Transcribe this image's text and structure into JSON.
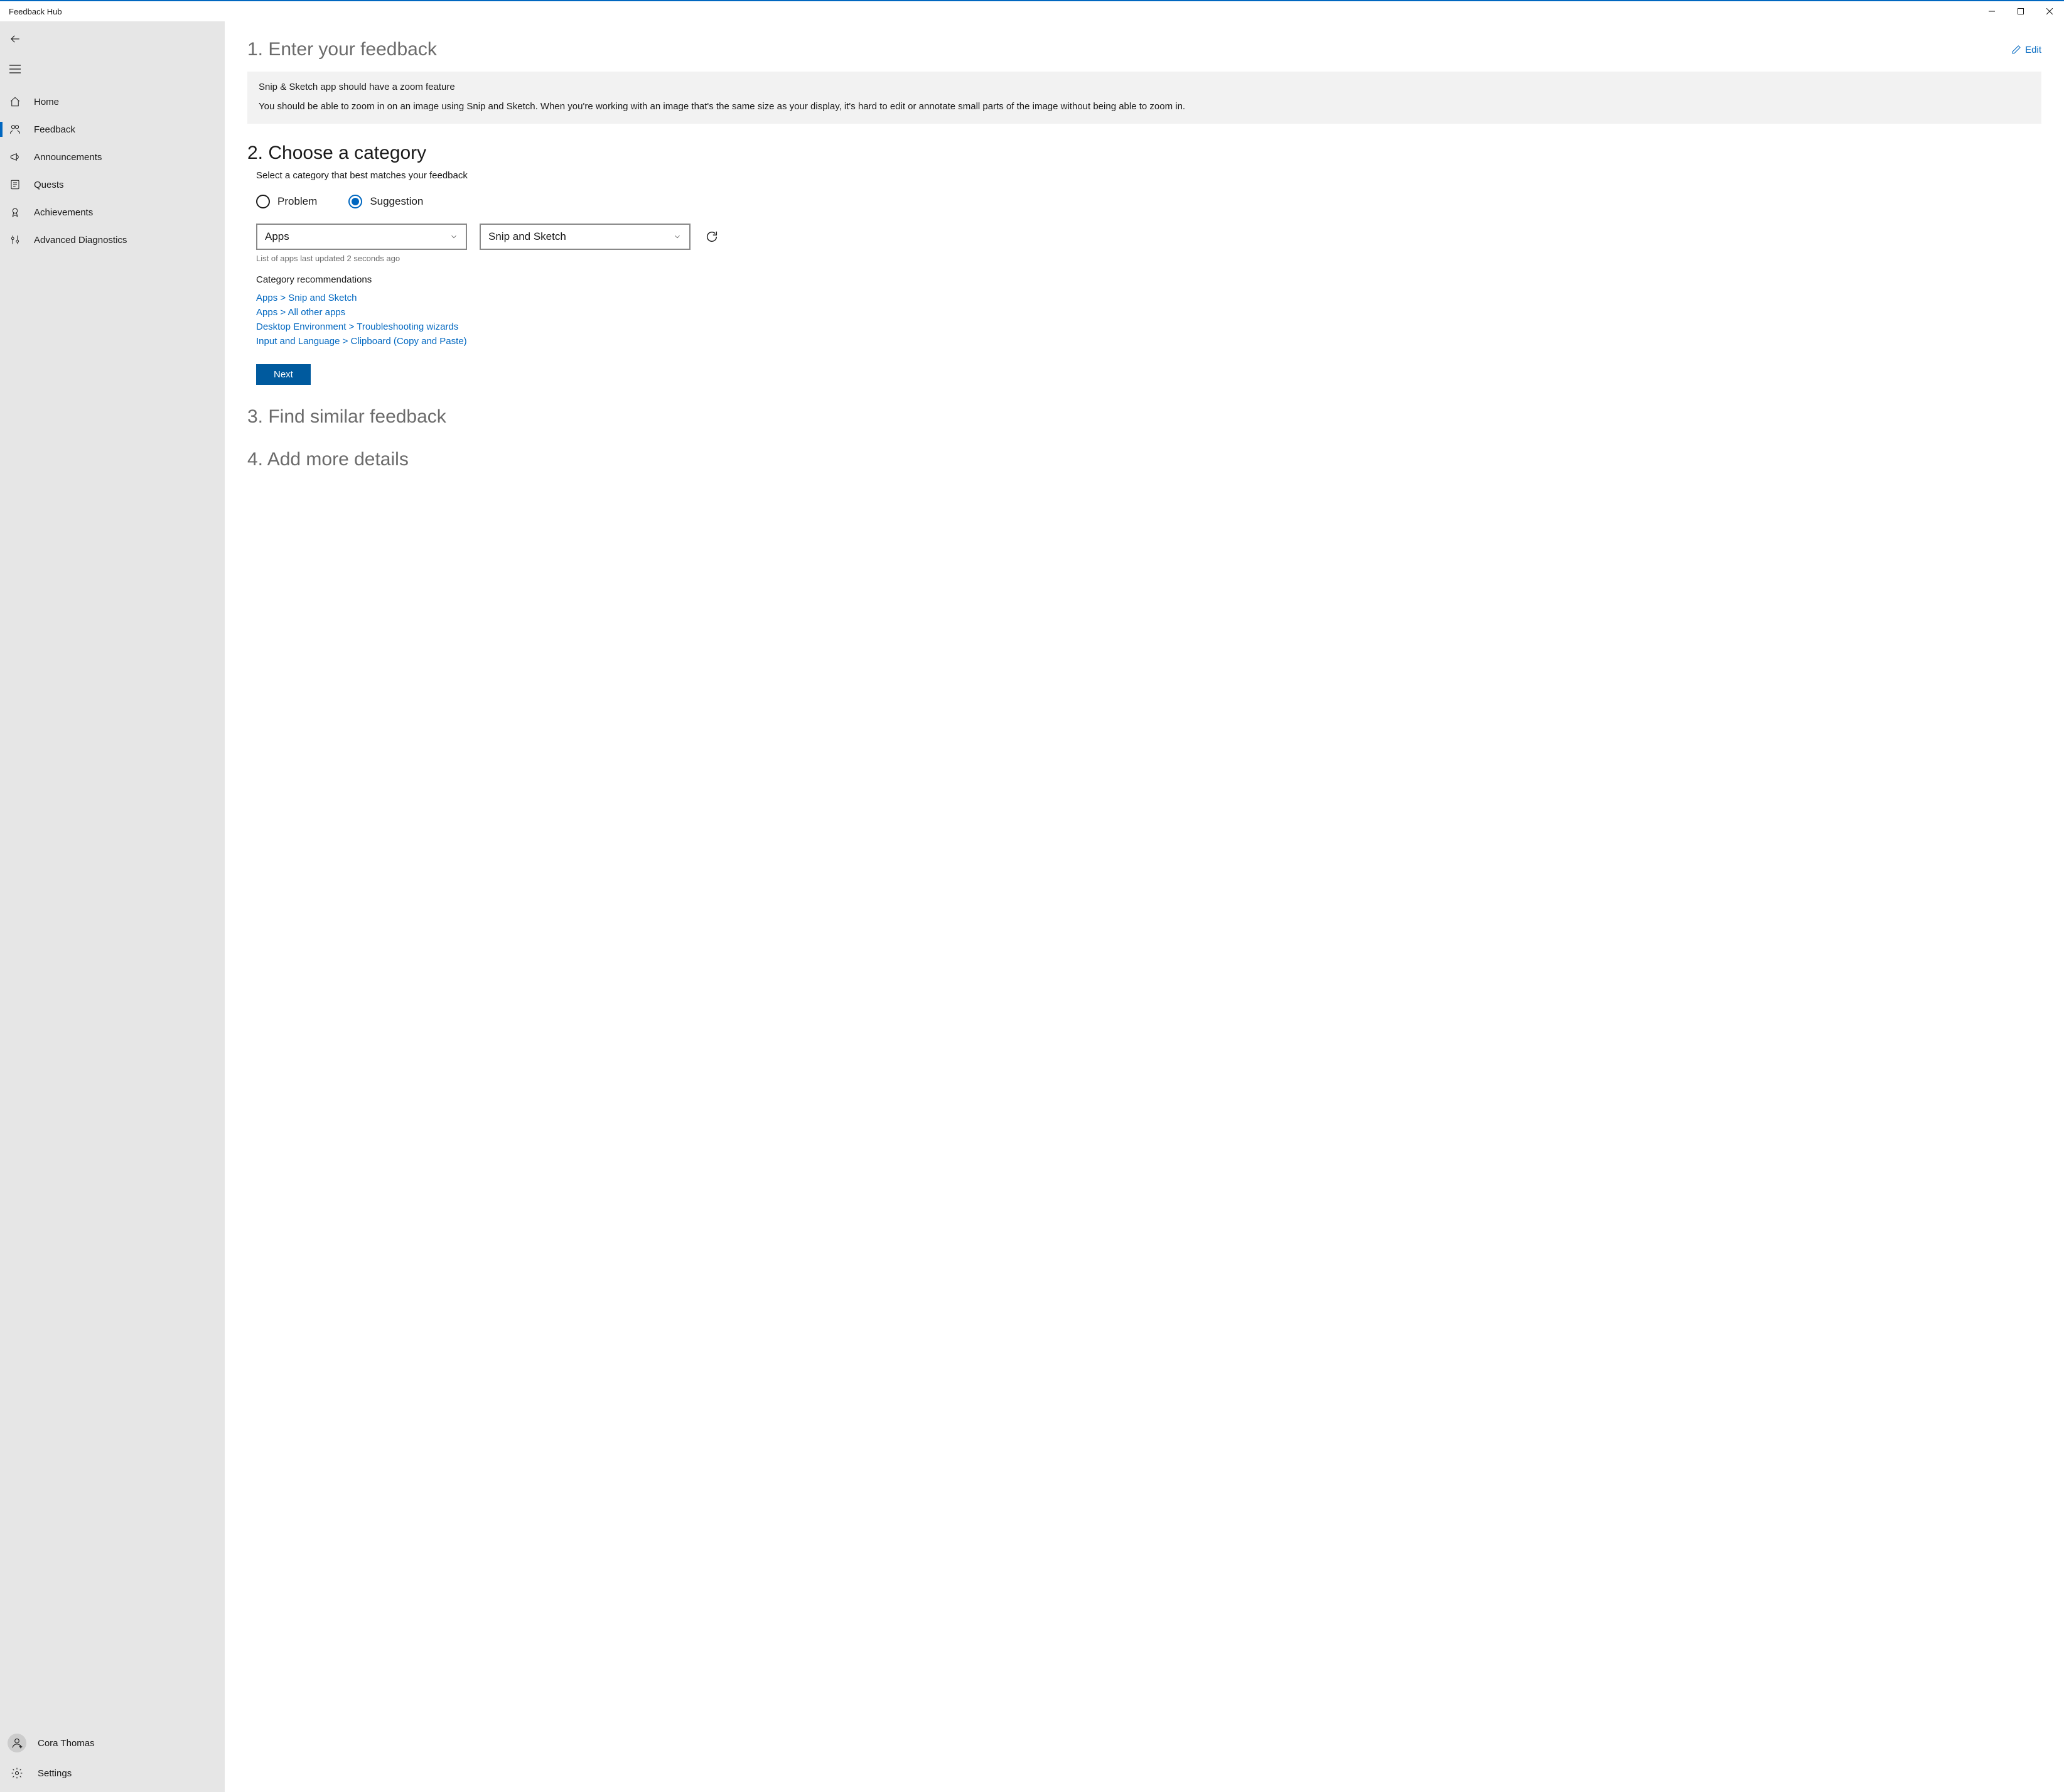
{
  "window": {
    "title": "Feedback Hub"
  },
  "sidebar": {
    "items": [
      {
        "label": "Home"
      },
      {
        "label": "Feedback"
      },
      {
        "label": "Announcements"
      },
      {
        "label": "Quests"
      },
      {
        "label": "Achievements"
      },
      {
        "label": "Advanced Diagnostics"
      }
    ],
    "user": {
      "name": "Cora Thomas"
    },
    "settings_label": "Settings"
  },
  "main": {
    "step1": {
      "title": "1. Enter your feedback",
      "edit_label": "Edit",
      "feedback_title": "Snip & Sketch app should have a zoom feature",
      "feedback_body": "You should be able to zoom in on an image using Snip and Sketch. When you're working with an image that's the same size as your display, it's hard to edit or annotate small parts of the image without being able to zoom in."
    },
    "step2": {
      "title": "2. Choose a category",
      "subtext": "Select a category that best matches your feedback",
      "radio_problem": "Problem",
      "radio_suggestion": "Suggestion",
      "dropdown1": "Apps",
      "dropdown2": "Snip and Sketch",
      "update_hint": "List of apps last updated 2 seconds ago",
      "reco_title": "Category recommendations",
      "recommendations": [
        "Apps > Snip and Sketch",
        "Apps > All other apps",
        "Desktop Environment > Troubleshooting wizards",
        "Input and Language > Clipboard (Copy and Paste)"
      ],
      "next_label": "Next"
    },
    "step3": {
      "title": "3. Find similar feedback"
    },
    "step4": {
      "title": "4. Add more details"
    }
  }
}
